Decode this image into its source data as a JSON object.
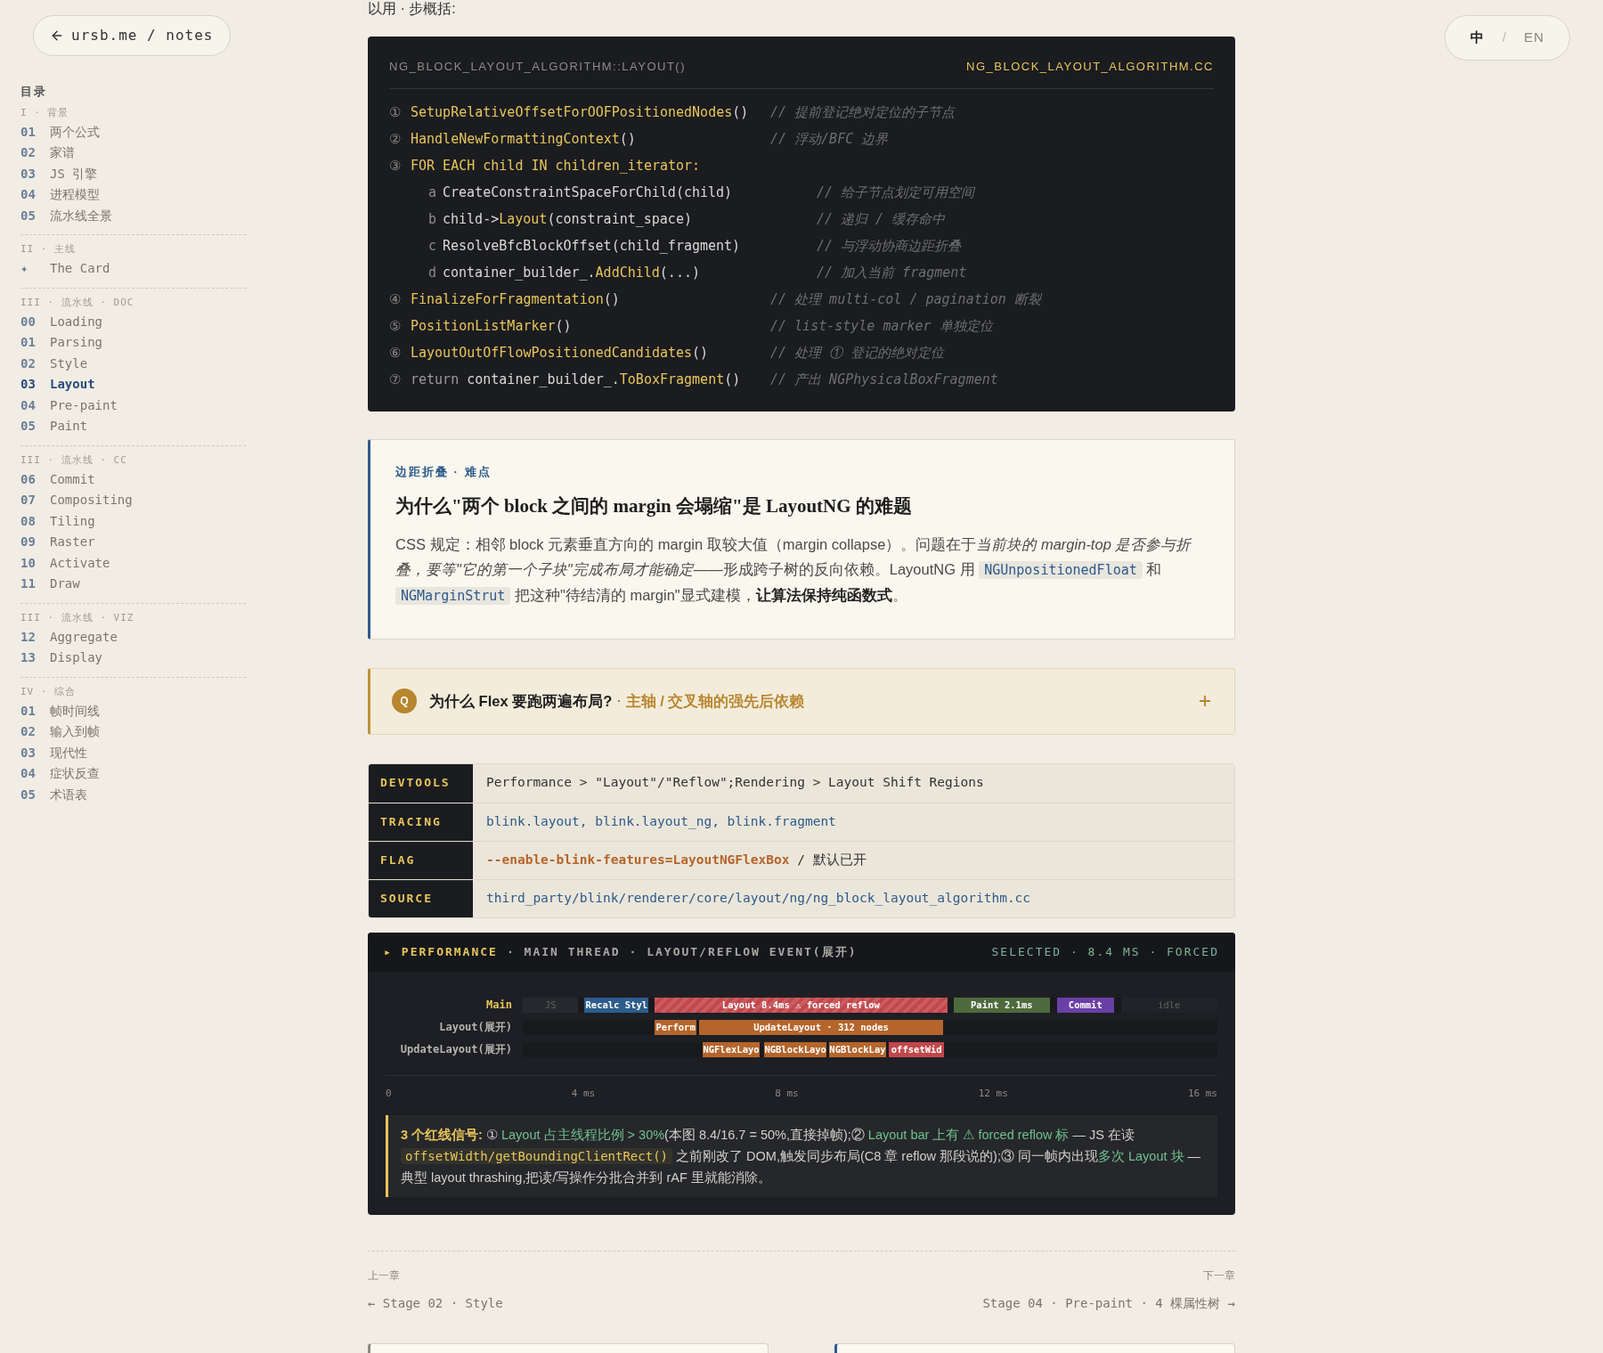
{
  "back_link": {
    "label": "ursb.me / notes"
  },
  "language_switch": {
    "separator": "/",
    "options": [
      {
        "label": "中",
        "selected": true
      },
      {
        "label": "EN",
        "selected": false
      }
    ]
  },
  "toc": {
    "title": "目录",
    "sections": [
      {
        "heading": "I · 背景",
        "items": [
          {
            "number": "01",
            "label": "两个公式",
            "selected": false
          },
          {
            "number": "02",
            "label": "家谱",
            "selected": false
          },
          {
            "number": "03",
            "label": "JS 引擎",
            "selected": false
          },
          {
            "number": "04",
            "label": "进程模型",
            "selected": false
          },
          {
            "number": "05",
            "label": "流水线全景",
            "selected": false
          }
        ]
      },
      {
        "heading": "II · 主线",
        "items": [
          {
            "number": "✦",
            "label": "The Card",
            "selected": false
          }
        ]
      },
      {
        "heading": "III · 流水线 · DOC",
        "items": [
          {
            "number": "00",
            "label": "Loading",
            "selected": false
          },
          {
            "number": "01",
            "label": "Parsing",
            "selected": false
          },
          {
            "number": "02",
            "label": "Style",
            "selected": false
          },
          {
            "number": "03",
            "label": "Layout",
            "selected": true
          },
          {
            "number": "04",
            "label": "Pre-paint",
            "selected": false
          },
          {
            "number": "05",
            "label": "Paint",
            "selected": false
          }
        ]
      },
      {
        "heading": "III · 流水线 · CC",
        "items": [
          {
            "number": "06",
            "label": "Commit",
            "selected": false
          },
          {
            "number": "07",
            "label": "Compositing",
            "selected": false
          },
          {
            "number": "08",
            "label": "Tiling",
            "selected": false
          },
          {
            "number": "09",
            "label": "Raster",
            "selected": false
          },
          {
            "number": "10",
            "label": "Activate",
            "selected": false
          },
          {
            "number": "11",
            "label": "Draw",
            "selected": false
          }
        ]
      },
      {
        "heading": "III · 流水线 · VIZ",
        "items": [
          {
            "number": "12",
            "label": "Aggregate",
            "selected": false
          },
          {
            "number": "13",
            "label": "Display",
            "selected": false
          }
        ]
      },
      {
        "heading": "IV · 综合",
        "items": [
          {
            "number": "01",
            "label": "帧时间线",
            "selected": false
          },
          {
            "number": "02",
            "label": "输入到帧",
            "selected": false
          },
          {
            "number": "03",
            "label": "现代性",
            "selected": false
          },
          {
            "number": "04",
            "label": "症状反查",
            "selected": false
          },
          {
            "number": "05",
            "label": "术语表",
            "selected": false
          }
        ]
      }
    ]
  },
  "intro_fragment": "以用 · 步概括:",
  "code_block": {
    "title": "NG_BLOCK_LAYOUT_ALGORITHM::LAYOUT()",
    "file": "NG_BLOCK_LAYOUT_ALGORITHM.CC",
    "lines": [
      {
        "kind": "step",
        "marker": "①",
        "tokens": [
          {
            "text": "SetupRelativeOffsetForOOFPositionedNodes",
            "kind": "fn"
          },
          {
            "text": "()",
            "kind": "plain"
          }
        ],
        "comment": "// 提前登记绝对定位的子节点"
      },
      {
        "kind": "step",
        "marker": "②",
        "tokens": [
          {
            "text": "HandleNewFormattingContext",
            "kind": "fn"
          },
          {
            "text": "()",
            "kind": "plain"
          }
        ],
        "comment": "// 浮动/BFC 边界"
      },
      {
        "kind": "step",
        "marker": "③",
        "tokens": [
          {
            "text": "FOR EACH child IN children_iterator:",
            "kind": "fn"
          }
        ]
      },
      {
        "kind": "substep",
        "marker": "a",
        "tokens": [
          {
            "text": "CreateConstraintSpaceForChild(child)",
            "kind": "plain"
          }
        ],
        "comment": "// 给子节点划定可用空间"
      },
      {
        "kind": "substep",
        "marker": "b",
        "tokens": [
          {
            "text": "child->",
            "kind": "plain"
          },
          {
            "text": "Layout",
            "kind": "fn"
          },
          {
            "text": "(constraint_space)",
            "kind": "plain"
          }
        ],
        "comment": "// 递归 / 缓存命中"
      },
      {
        "kind": "substep",
        "marker": "c",
        "tokens": [
          {
            "text": "ResolveBfcBlockOffset(child_fragment)",
            "kind": "plain"
          }
        ],
        "comment": "// 与浮动协商边距折叠"
      },
      {
        "kind": "substep",
        "marker": "d",
        "tokens": [
          {
            "text": "container_builder_.",
            "kind": "plain"
          },
          {
            "text": "AddChild",
            "kind": "fn"
          },
          {
            "text": "(...)",
            "kind": "plain"
          }
        ],
        "comment": "// 加入当前 fragment"
      },
      {
        "kind": "step",
        "marker": "④",
        "tokens": [
          {
            "text": "FinalizeForFragmentation",
            "kind": "fn"
          },
          {
            "text": "()",
            "kind": "plain"
          }
        ],
        "comment": "// 处理 multi-col / pagination 断裂"
      },
      {
        "kind": "step",
        "marker": "⑤",
        "tokens": [
          {
            "text": "PositionListMarker",
            "kind": "fn"
          },
          {
            "text": "()",
            "kind": "plain"
          }
        ],
        "comment": "// list-style marker 单独定位"
      },
      {
        "kind": "step",
        "marker": "⑥",
        "tokens": [
          {
            "text": "LayoutOutOfFlowPositionedCandidates",
            "kind": "fn"
          },
          {
            "text": "()",
            "kind": "plain"
          }
        ],
        "comment": "// 处理 ① 登记的绝对定位"
      },
      {
        "kind": "step",
        "marker": "⑦",
        "tokens": [
          {
            "text": "return",
            "kind": "keyword"
          },
          {
            "text": " container_builder_.",
            "kind": "plain"
          },
          {
            "text": "ToBoxFragment",
            "kind": "fn"
          },
          {
            "text": "()",
            "kind": "plain"
          }
        ],
        "comment": "// 产出 NGPhysicalBoxFragment"
      }
    ]
  },
  "callout": {
    "tag": "边距折叠 · 难点",
    "title": "为什么\"两个 block 之间的 margin 会塌缩\"是 LayoutNG 的难题",
    "body": [
      {
        "text": "CSS 规定：相邻 block 元素垂直方向的 margin 取较大值（margin collapse）。问题在于",
        "kind": "plain"
      },
      {
        "text": "当前块的 margin-top 是否参与折叠，要等\"它的第一个子块\"完成布局才能确定",
        "kind": "italic"
      },
      {
        "text": "——形成跨子树的反向依赖。LayoutNG 用 ",
        "kind": "plain"
      },
      {
        "text": "NGUnpositionedFloat",
        "kind": "code"
      },
      {
        "text": " 和 ",
        "kind": "plain"
      },
      {
        "text": "NGMarginStrut",
        "kind": "code"
      },
      {
        "text": " 把这种\"待结清的 margin\"显式建模，",
        "kind": "plain"
      },
      {
        "text": "让算法保持纯函数式",
        "kind": "bold"
      },
      {
        "text": "。",
        "kind": "plain"
      }
    ]
  },
  "question": {
    "badge": "Q",
    "text": "为什么 Flex 要跑两遍布局?",
    "separator": "·",
    "hint": "主轴 / 交叉轴的强先后依赖",
    "expanded": false
  },
  "reference_table": [
    {
      "key": "DEVTOOLS",
      "value": [
        {
          "text": "Performance > \"Layout\"/\"Reflow\";Rendering > Layout Shift Regions",
          "kind": "plain"
        }
      ]
    },
    {
      "key": "TRACING",
      "value": [
        {
          "text": "blink.layout, blink.layout_ng, blink.fragment",
          "kind": "link"
        }
      ]
    },
    {
      "key": "FLAG",
      "value": [
        {
          "text": "--enable-blink-features=LayoutNGFlexBox",
          "kind": "flag"
        },
        {
          "text": " / 默认已开",
          "kind": "plain"
        }
      ]
    },
    {
      "key": "SOURCE",
      "value": [
        {
          "text": "third_party/blink/renderer/core/layout/ng/ng_block_layout_algorithm.cc",
          "kind": "link"
        }
      ]
    }
  ],
  "performance_panel": {
    "marker": "▸",
    "title": "PERFORMANCE",
    "subtitle": "· MAIN THREAD · LAYOUT/REFLOW EVENT(展开)",
    "status": "SELECTED · 8.4 MS · FORCED",
    "tracks": [
      {
        "label": "Main",
        "highlighted": true,
        "segments": [
          {
            "label": "JS",
            "kind": "muted",
            "color": "#26282e"
          },
          {
            "label": "Recalc Styl",
            "kind": "solid",
            "color": "#2c5d8c"
          },
          {
            "label": "Layout 8.4ms ⚠ forced reflow",
            "kind": "striped",
            "color": "#c2474b"
          },
          {
            "label": "Paint 2.1ms",
            "kind": "solid",
            "color": "#4d6b3c"
          },
          {
            "label": "Commit",
            "kind": "solid",
            "color": "#6a40a6"
          },
          {
            "label": "idle",
            "kind": "muted",
            "color": "#222328"
          }
        ]
      },
      {
        "label": "Layout(展开)",
        "highlighted": false,
        "segments": [
          {
            "label": "Perform",
            "kind": "solid",
            "color": "#b5652b"
          },
          {
            "label": "UpdateLayout · 312 nodes",
            "kind": "solid",
            "color": "#b5652b"
          }
        ]
      },
      {
        "label": "UpdateLayout(展开)",
        "highlighted": false,
        "segments": [
          {
            "label": "NGFlexLayo",
            "kind": "solid",
            "color": "#b5652b"
          },
          {
            "label": "NGBlockLayo",
            "kind": "solid",
            "color": "#b5652b"
          },
          {
            "label": "NGBlockLay",
            "kind": "solid",
            "color": "#b5652b"
          },
          {
            "label": "offsetWid",
            "kind": "solid",
            "color": "#c2474b"
          }
        ]
      }
    ],
    "axis_ticks": [
      "0",
      "4 ms",
      "8 ms",
      "12 ms",
      "16 ms"
    ],
    "note": [
      {
        "text": "3 个红线信号:",
        "kind": "label"
      },
      {
        "text": " ① ",
        "kind": "plain"
      },
      {
        "text": "Layout 占主线程比例 > 30%",
        "kind": "green"
      },
      {
        "text": "(本图 8.4/16.7 = 50%,直接掉帧);② ",
        "kind": "plain"
      },
      {
        "text": "Layout bar 上有 ⚠ forced reflow 标",
        "kind": "green"
      },
      {
        "text": " — JS 在读 ",
        "kind": "plain"
      },
      {
        "text": "offsetWidth/getBoundingClientRect()",
        "kind": "code"
      },
      {
        "text": " 之前刚改了 DOM,触发同步布局(C8 章 reflow 那段说的);③ 同一帧内出现",
        "kind": "plain"
      },
      {
        "text": "多次 Layout 块",
        "kind": "green"
      },
      {
        "text": " — 典型 layout thrashing,把读/写操作分批合并到 rAF 里就能消除。",
        "kind": "plain"
      }
    ]
  },
  "chapter_nav": {
    "previous": {
      "caption": "上一章",
      "label": "← Stage 02 · Style"
    },
    "next": {
      "caption": "下一章",
      "label": "Stage 04 · Pre-paint · 4 棵属性树 →"
    }
  }
}
